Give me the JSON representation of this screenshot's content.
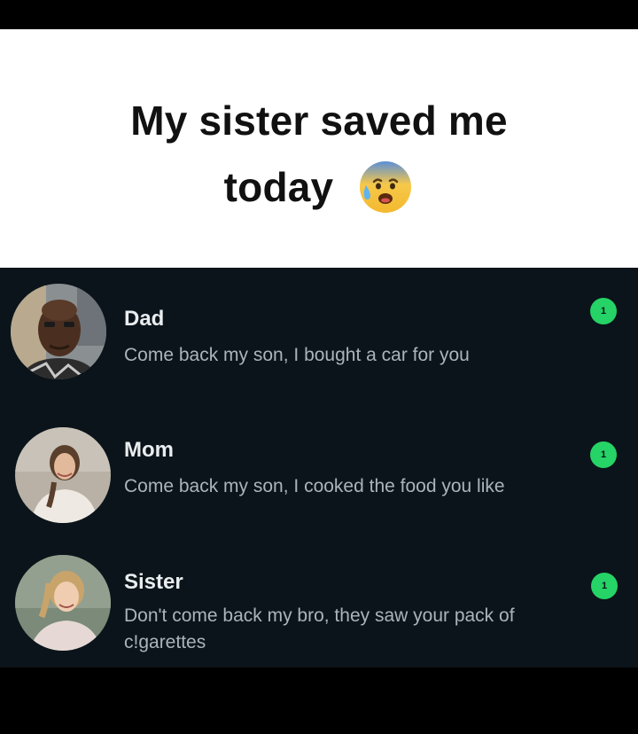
{
  "caption": {
    "line1": "My sister saved me",
    "line2": "today",
    "emoji_icon": "anxious-face-with-sweat-icon"
  },
  "chats": [
    {
      "name": "Dad",
      "message": "Come back my son, I bought a car for you",
      "unread": "1",
      "avatar_icon": "avatar-photo-icon"
    },
    {
      "name": "Mom",
      "message": "Come back my son, I cooked the food you like",
      "unread": "1",
      "avatar_icon": "avatar-photo-icon"
    },
    {
      "name": "Sister",
      "message": "Don't come back my bro, they saw your pack of c!garettes",
      "unread": "1",
      "avatar_icon": "avatar-photo-icon"
    }
  ],
  "colors": {
    "background": "#0b141a",
    "unread_badge": "#25d366",
    "name_text": "#e9edef",
    "message_text": "#aab4ba"
  }
}
